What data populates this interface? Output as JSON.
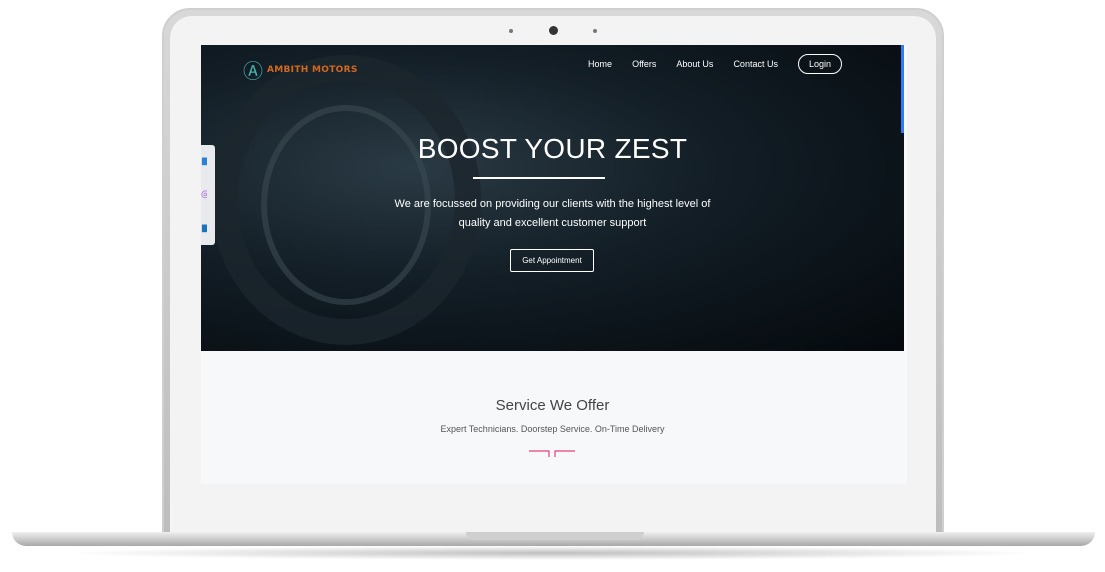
{
  "brand": {
    "name": "AMBITH MOTORS",
    "logo_color": "#d2691e",
    "mark_color": "#4ab3b0"
  },
  "nav": {
    "items": [
      "Home",
      "Offers",
      "About Us",
      "Contact Us"
    ],
    "login": "Login"
  },
  "social": [
    "facebook-icon",
    "instagram-icon",
    "linkedin-icon"
  ],
  "hero": {
    "title": "BOOST YOUR ZEST",
    "subtitle_line1": "We are focussed on providing our clients with the highest level of",
    "subtitle_line2": "quality and excellent customer support",
    "cta": "Get Appointment"
  },
  "services": {
    "title": "Service We Offer",
    "subtitle": "Expert Technicians. Doorstep Service. On-Time Delivery",
    "accent": "#e8417a"
  }
}
